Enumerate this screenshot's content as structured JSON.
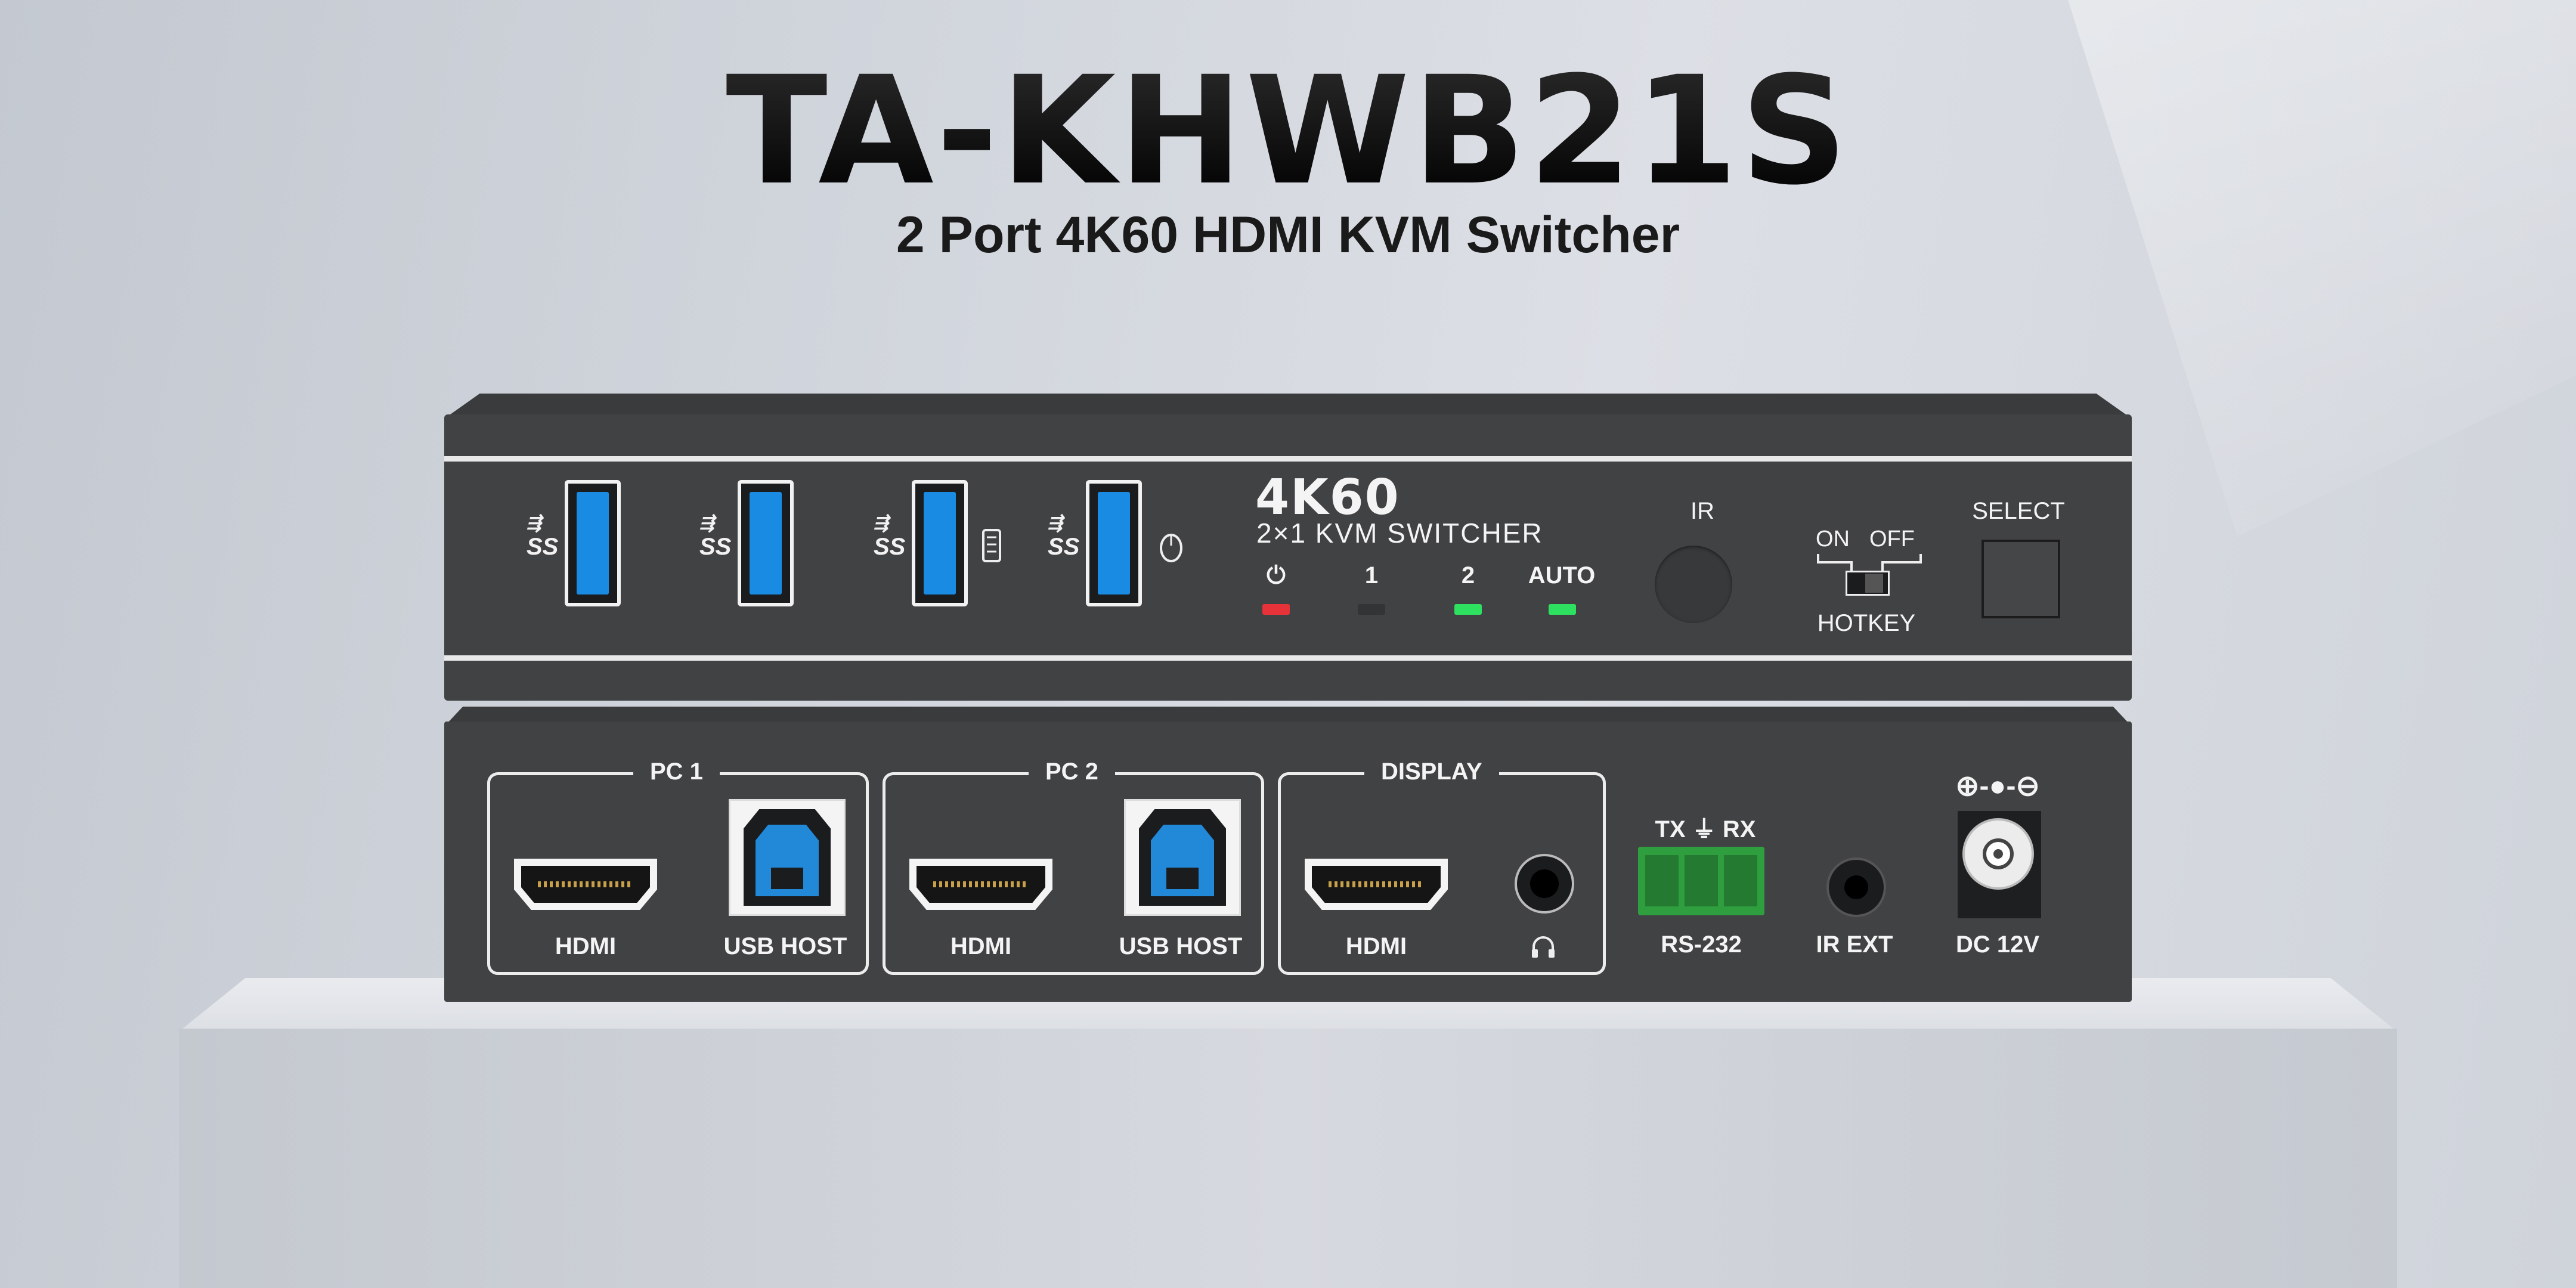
{
  "headline": {
    "model": "TA-KHWB21S",
    "subtitle": "2 Port 4K60 HDMI KVM Switcher"
  },
  "front_panel": {
    "brand_line1": "4K60",
    "brand_line2": "2×1 KVM SWITCHER",
    "usb_mark": "SS",
    "leds": [
      {
        "label": "⏻",
        "color": "#e8323a"
      },
      {
        "label": "1",
        "color": "#333436"
      },
      {
        "label": "2",
        "color": "#2ee060"
      },
      {
        "label": "AUTO",
        "color": "#2ee060"
      }
    ],
    "ir_label": "IR",
    "hotkey": {
      "on": "ON",
      "off": "OFF",
      "label": "HOTKEY"
    },
    "select_label": "SELECT"
  },
  "rear_panel": {
    "groups": [
      {
        "title": "PC 1",
        "ports": [
          "HDMI",
          "USB HOST"
        ]
      },
      {
        "title": "PC 2",
        "ports": [
          "HDMI",
          "USB HOST"
        ]
      },
      {
        "title": "DISPLAY",
        "ports": [
          "HDMI"
        ]
      }
    ],
    "rs232": {
      "top": "TX ⏚ RX",
      "label": "RS-232"
    },
    "ir_ext": "IR EXT",
    "dc": {
      "polarity": "⊕-●-⊖",
      "label": "DC 12V"
    }
  },
  "colors": {
    "chassis": "#414244",
    "usb_blue": "#1a8be2",
    "terminal_green": "#2e9e3e"
  }
}
